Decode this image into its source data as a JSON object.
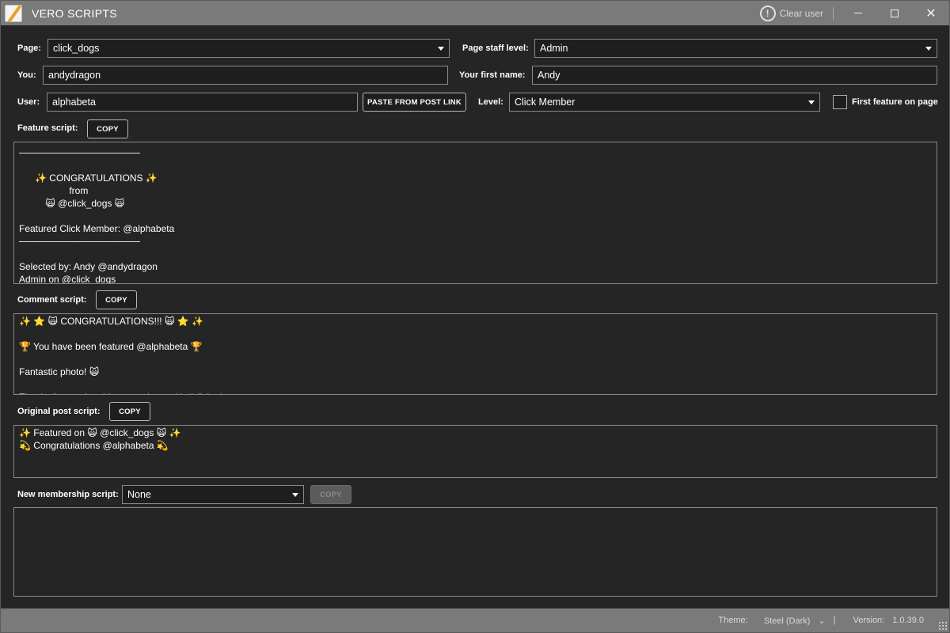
{
  "window": {
    "title": "VERO SCRIPTS",
    "clear_user_label": "Clear user",
    "minimize_glyph": "—",
    "close_glyph": "✕"
  },
  "form": {
    "page_label": "Page:",
    "page_value": "click_dogs",
    "staff_level_label": "Page staff level:",
    "staff_level_value": "Admin",
    "you_label": "You:",
    "you_value": "andydragon",
    "first_name_label": "Your first name:",
    "first_name_value": "Andy",
    "user_label": "User:",
    "user_value": "alphabeta",
    "paste_button": "PASTE FROM POST LINK",
    "level_label": "Level:",
    "level_value": "Click Member",
    "first_feature_label": "First feature on page"
  },
  "feature_script": {
    "label": "Feature script:",
    "copy_label": "COPY",
    "lines": [
      "──────────────────",
      "",
      "      ✨ CONGRATULATIONS ✨",
      "                   from",
      "          🙀 @click_dogs 🙀",
      "",
      "Featured Click Member: @alphabeta",
      "──────────────────",
      "",
      "Selected by: Andy @andydragon",
      "Admin on @click_dogs"
    ]
  },
  "comment_script": {
    "label": "Comment script:",
    "copy_label": "COPY",
    "lines": [
      "✨ ⭐ 🙀 CONGRATULATIONS!!! 🙀 ⭐ ✨",
      "",
      "🏆 You have been featured @alphabeta 🏆",
      "",
      "Fantastic photo! 🙀",
      "",
      "Thanks for tagging this great photo with #click_dogs"
    ]
  },
  "original_post_script": {
    "label": "Original post script:",
    "copy_label": "COPY",
    "lines": [
      "✨ Featured on 🙀 @click_dogs 🙀 ✨",
      "💫 Congratulations @alphabeta 💫"
    ]
  },
  "new_membership_script": {
    "label": "New membership script:",
    "value": "None",
    "copy_label": "COPY",
    "lines": []
  },
  "status": {
    "theme_label": "Theme:",
    "theme_value": "Steel (Dark)",
    "separator": "|",
    "version_label": "Version:",
    "version_value": "1.0.39.0"
  },
  "colors": {
    "background": "#252525",
    "titlebar": "#7a7a7a",
    "field_border": "#8a8a8a"
  }
}
